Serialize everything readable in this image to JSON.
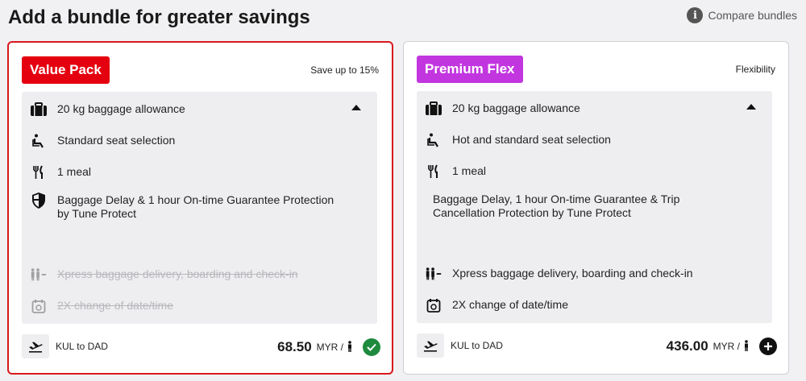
{
  "header": {
    "title": "Add a bundle for greater savings",
    "compare_label": "Compare bundles",
    "compare_icon": "info-icon"
  },
  "bundles": [
    {
      "name": "Value Pack",
      "badge_color": "#e4000f",
      "tagline": "Save up to 15%",
      "selected": true,
      "benefits": [
        {
          "icon": "luggage-icon",
          "text": "20 kg baggage allowance",
          "included": true
        },
        {
          "icon": "seat-icon",
          "text": "Standard seat selection",
          "included": true
        },
        {
          "icon": "meal-icon",
          "text": "1 meal",
          "included": true
        },
        {
          "icon": "shield-icon",
          "text": "Baggage Delay & 1 hour On-time Guarantee Protection by Tune Protect",
          "included": true
        },
        {
          "icon": "xpress-icon",
          "text": "Xpress baggage delivery, boarding and check-in",
          "included": false
        },
        {
          "icon": "calendar-icon",
          "text": "2X change of date/time",
          "included": false
        }
      ],
      "route": "KUL to DAD",
      "price": "68.50",
      "currency": "MYR /",
      "action_icon": "check-icon"
    },
    {
      "name": "Premium Flex",
      "badge_color": "#c236e0",
      "tagline": "Flexibility",
      "selected": false,
      "benefits": [
        {
          "icon": "luggage-icon",
          "text": "20 kg baggage allowance",
          "included": true
        },
        {
          "icon": "seat-icon",
          "text": "Hot and standard seat selection",
          "included": true
        },
        {
          "icon": "meal-icon",
          "text": "1 meal",
          "included": true
        },
        {
          "icon": "",
          "text": "Baggage Delay, 1 hour On-time Guarantee & Trip Cancellation Protection by Tune Protect",
          "included": true
        },
        {
          "icon": "xpress-icon",
          "text": "Xpress baggage delivery, boarding and check-in",
          "included": true
        },
        {
          "icon": "calendar-icon",
          "text": "2X change of date/time",
          "included": true
        }
      ],
      "route": "KUL to DAD",
      "price": "436.00",
      "currency": "MYR /",
      "action_icon": "plus-icon"
    }
  ]
}
